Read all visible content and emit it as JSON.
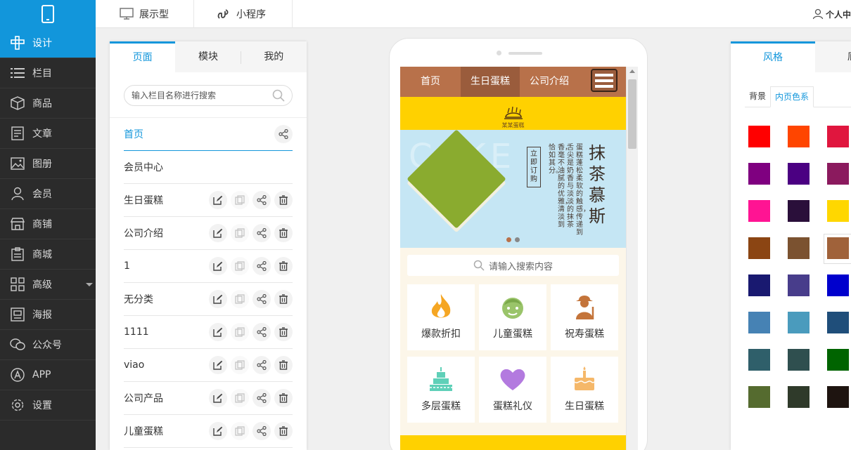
{
  "topbar": {
    "tabs": [
      {
        "label": "展示型",
        "icon": "monitor-icon"
      },
      {
        "label": "小程序",
        "icon": "mini-program-icon"
      }
    ],
    "user_label": "个人中"
  },
  "sidebar": {
    "items": [
      {
        "label": "设计",
        "icon": "design-icon",
        "active": true
      },
      {
        "label": "栏目",
        "icon": "list-icon"
      },
      {
        "label": "商品",
        "icon": "box-icon"
      },
      {
        "label": "文章",
        "icon": "article-icon"
      },
      {
        "label": "图册",
        "icon": "image-icon"
      },
      {
        "label": "会员",
        "icon": "user-icon"
      },
      {
        "label": "商铺",
        "icon": "shop-icon"
      },
      {
        "label": "商城",
        "icon": "mall-icon"
      },
      {
        "label": "高级",
        "icon": "grid-icon"
      },
      {
        "label": "海报",
        "icon": "poster-icon"
      },
      {
        "label": "公众号",
        "icon": "wechat-icon"
      },
      {
        "label": "APP",
        "icon": "app-icon"
      },
      {
        "label": "设置",
        "icon": "gear-icon"
      }
    ]
  },
  "pagepanel": {
    "tabs": [
      "页面",
      "模块",
      "我的"
    ],
    "search_placeholder": "输入栏目名称进行搜索",
    "pages": [
      "首页",
      "会员中心",
      "生日蛋糕",
      "公司介绍",
      "1",
      "无分类",
      "1111",
      "viao",
      "公司产品",
      "儿童蛋糕"
    ]
  },
  "mobile": {
    "nav": [
      "首页",
      "生日蛋糕",
      "公司介绍"
    ],
    "brand_text": "某某蛋糕",
    "banner": {
      "title": "抹茶慕斯",
      "bg_word": "CAKE",
      "button": "立即订购",
      "desc_lines": [
        "蛋糕蓬松柔软的触感，传递到",
        "舌尖是奶香与淡淡的抹茶",
        "香，毫不油腻的优雅，清淡到",
        "恰如其分。"
      ]
    },
    "search_placeholder": "请输入搜索内容",
    "grid": [
      {
        "label": "爆款折扣",
        "icon": "fire-icon",
        "color": "#f5a623"
      },
      {
        "label": "儿童蛋糕",
        "icon": "child-face-icon",
        "color": "#9ac46a"
      },
      {
        "label": "祝寿蛋糕",
        "icon": "elder-icon",
        "color": "#c4743a"
      },
      {
        "label": "多层蛋糕",
        "icon": "tiered-cake-icon",
        "color": "#5fd0b8"
      },
      {
        "label": "蛋糕礼仪",
        "icon": "heart-icon",
        "color": "#b37adf"
      },
      {
        "label": "生日蛋糕",
        "icon": "birthday-cake-icon",
        "color": "#f5b86a"
      }
    ]
  },
  "rightpanel": {
    "tabs": [
      "风格",
      "底部"
    ],
    "subtabs": [
      "背景",
      "内页色系"
    ],
    "swatches": [
      "#ff0000",
      "#ff4500",
      "#e0163e",
      "#7f0080",
      "#4b0082",
      "#8b1a5e",
      "#ff1493",
      "#2a0f3a",
      "#ffd700",
      "#8b4513",
      "#7b5230",
      "#a0623a",
      "#191970",
      "#483d8b",
      "#0000cd",
      "#4682b4",
      "#4a9bbd",
      "#1f4e7a",
      "#2f5f6a",
      "#2f4f4f",
      "#006400",
      "#556b2f",
      "#2f3a2a",
      "#1e1410"
    ],
    "selected_swatch": 11
  }
}
